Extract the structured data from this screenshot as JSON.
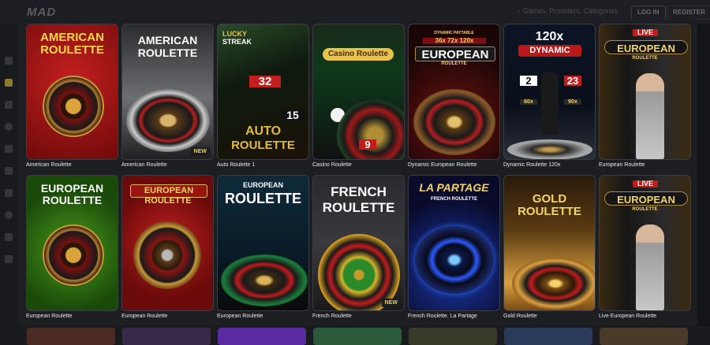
{
  "app": {
    "logo": "MAD",
    "search_placeholder": "Games, Providers, Categories",
    "login_label": "LOG IN",
    "register_label": "REGISTER"
  },
  "games": [
    {
      "caption": "American Roulette",
      "art_lines": [
        "AMERICAN",
        "ROULETTE"
      ],
      "badge": ""
    },
    {
      "caption": "American Roulette",
      "art_lines": [
        "AMERICAN",
        "ROULETTE"
      ],
      "badge": "NEW"
    },
    {
      "caption": "Auto Roulette 1",
      "art_lines": [
        "LUCKY",
        "STREAK",
        "AUTO",
        "ROULETTE",
        "32",
        "15"
      ],
      "badge": ""
    },
    {
      "caption": "Casino Roulette",
      "art_lines": [
        "Casino Roulette",
        "9"
      ],
      "badge": ""
    },
    {
      "caption": "Dynamic European Roulette",
      "art_lines": [
        "DYNAMIC PAYTABLE",
        "36x 72x 120x",
        "EUROPEAN",
        "ROULETTE"
      ],
      "badge": ""
    },
    {
      "caption": "Dynamic Roulette 120x",
      "art_lines": [
        "120x",
        "DYNAMIC",
        "2",
        "23",
        "60x",
        "90x"
      ],
      "badge": ""
    },
    {
      "caption": "European Roulette",
      "art_lines": [
        "LIVE",
        "EUROPEAN",
        "ROULETTE"
      ],
      "badge": ""
    },
    {
      "caption": "European Roulette",
      "art_lines": [
        "EUROPEAN",
        "ROULETTE"
      ],
      "badge": ""
    },
    {
      "caption": "European Roulette",
      "art_lines": [
        "EUROPEAN",
        "ROULETTE"
      ],
      "badge": ""
    },
    {
      "caption": "European Roulette",
      "art_lines": [
        "EUROPEAN",
        "ROULETTE"
      ],
      "badge": ""
    },
    {
      "caption": "French Roulette",
      "art_lines": [
        "FRENCH",
        "ROULETTE"
      ],
      "badge": "NEW"
    },
    {
      "caption": "French Roulette. La Partage",
      "art_lines": [
        "LA PARTAGE",
        "FRENCH ROULETTE"
      ],
      "badge": ""
    },
    {
      "caption": "Gold Roulette",
      "art_lines": [
        "GOLD",
        "ROULETTE"
      ],
      "badge": ""
    },
    {
      "caption": "Live European Roulette",
      "art_lines": [
        "LIVE",
        "EUROPEAN",
        "ROULETTE"
      ],
      "badge": ""
    }
  ]
}
